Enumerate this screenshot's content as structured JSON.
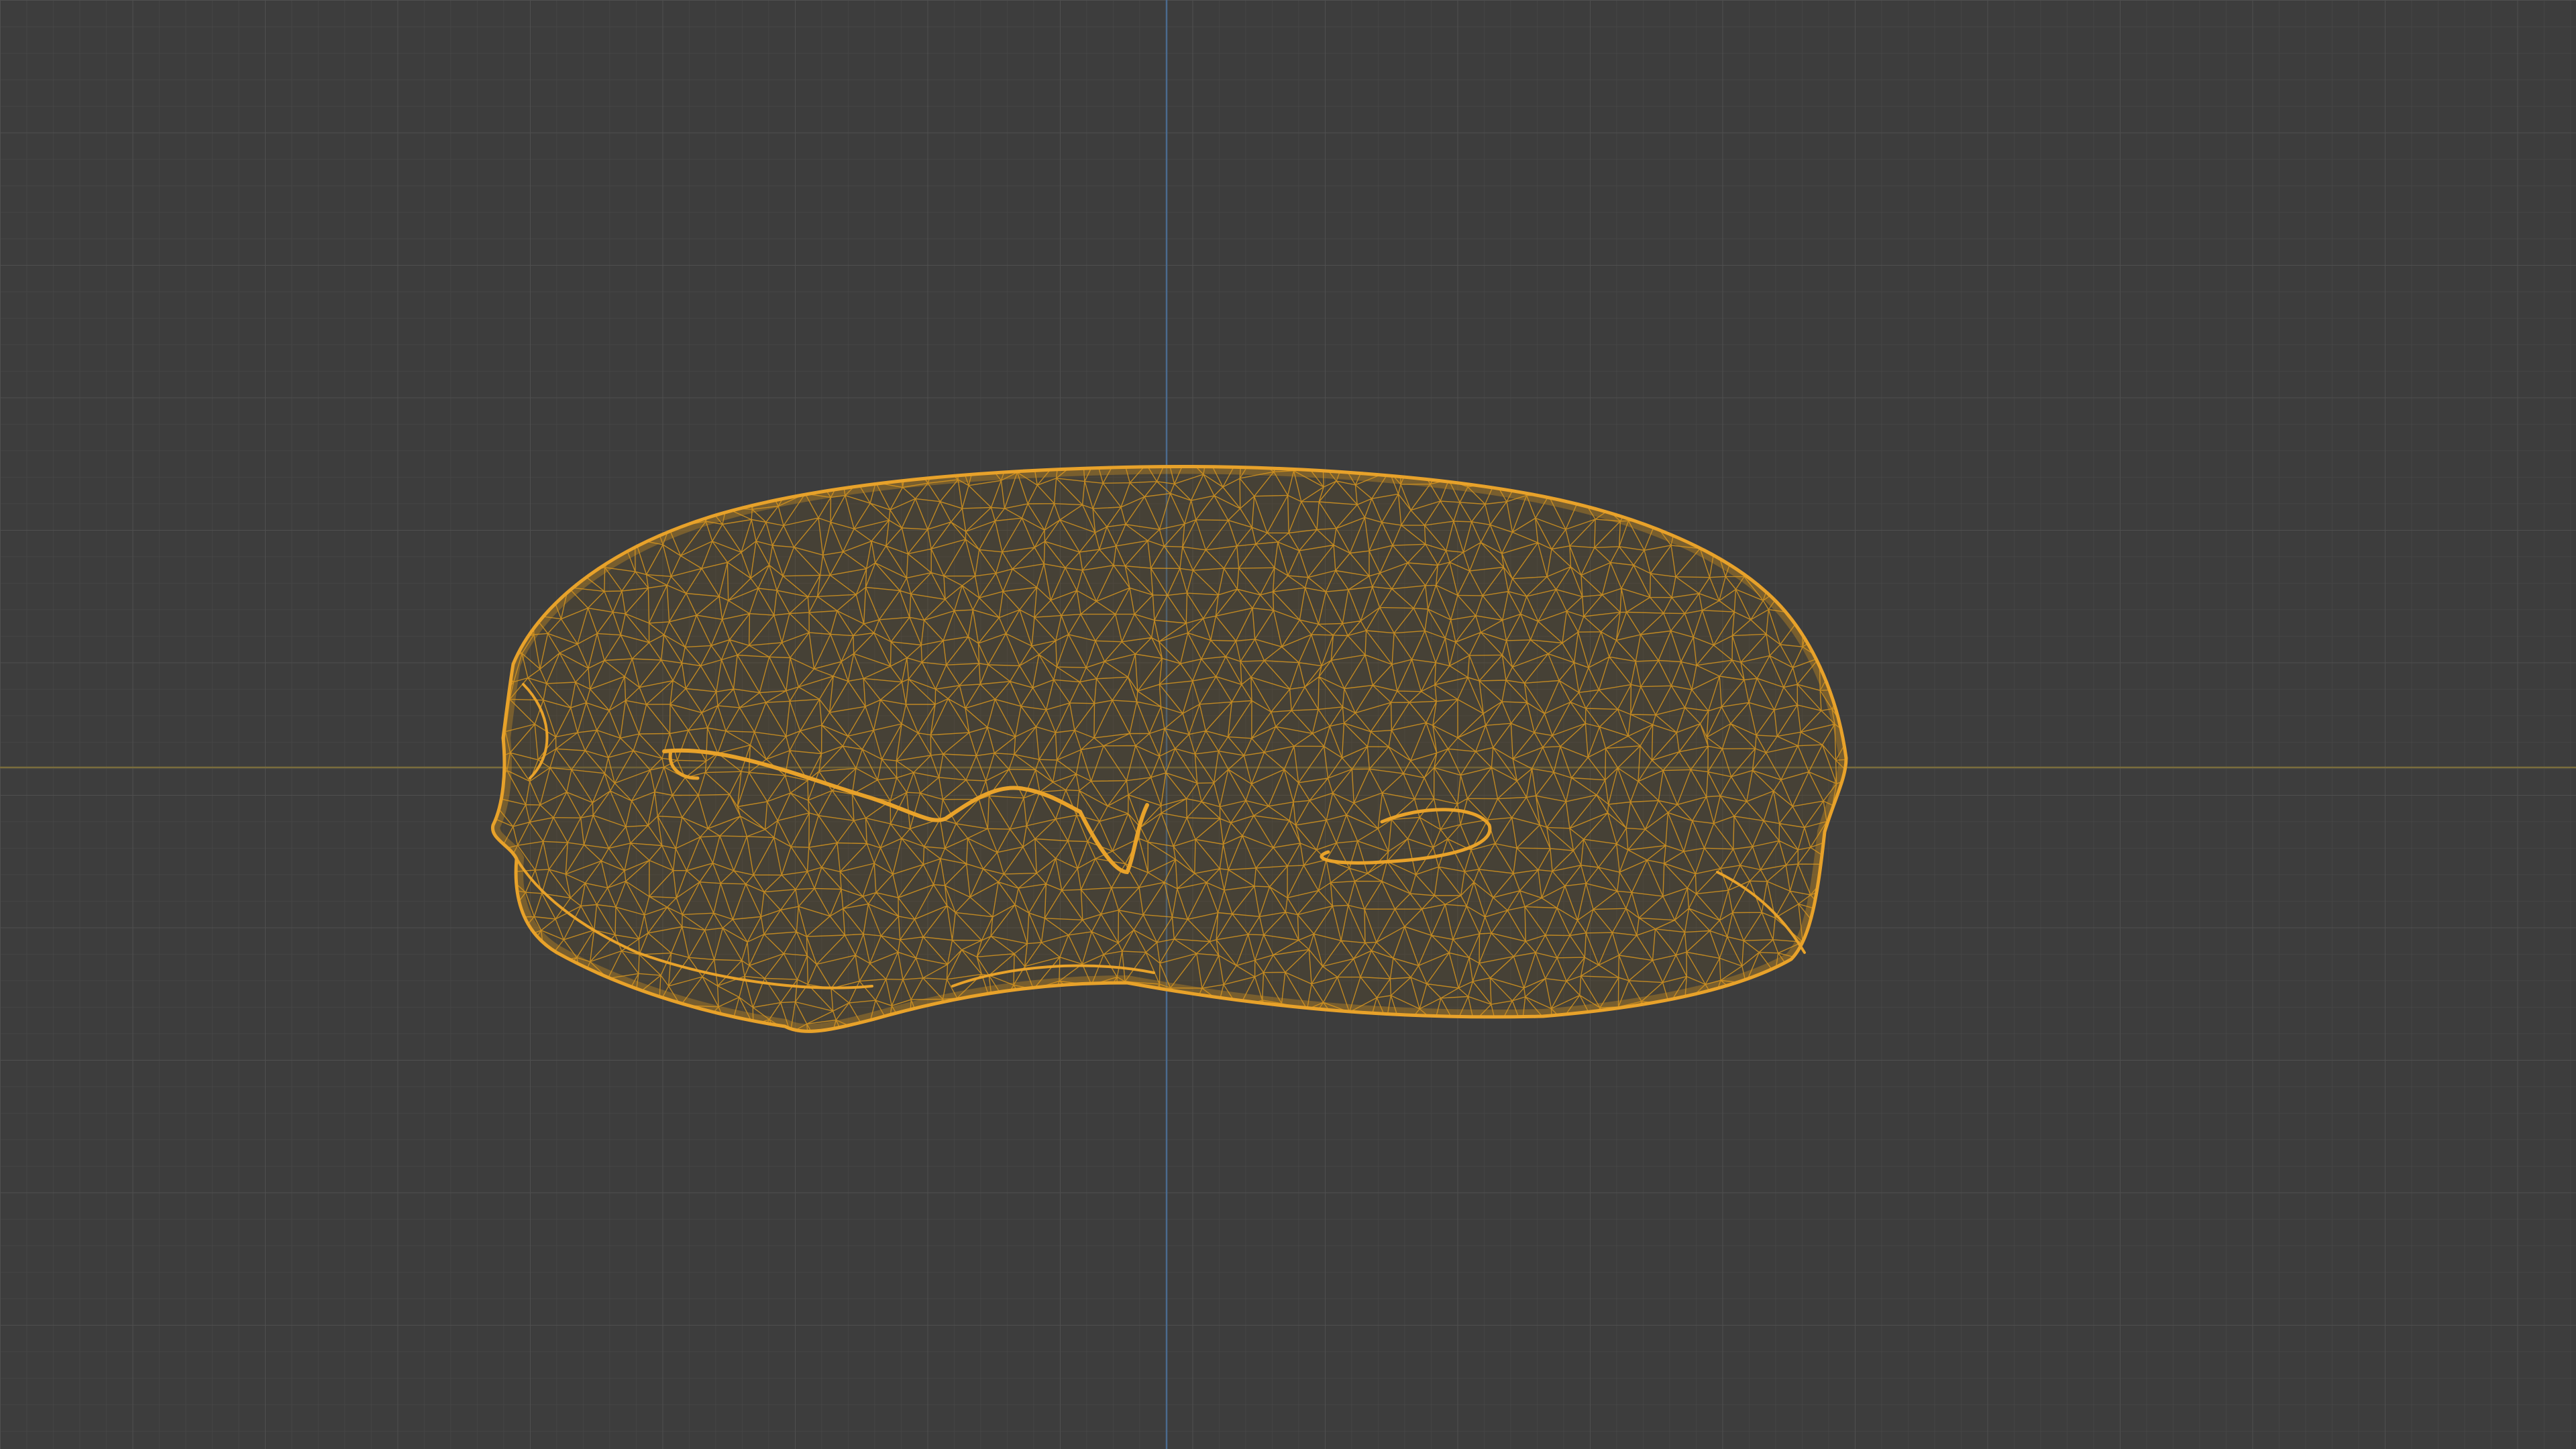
{
  "viewport": {
    "view": "front-orthographic",
    "shading_mode": "wireframe",
    "background_color": "#3d3d3d",
    "grid_minor_color": "#474747",
    "grid_major_color": "#505050",
    "x_axis_color": "#7a6d3d",
    "z_axis_color": "#4a6a8e",
    "selected_object_color": "#e8a22a",
    "selected_object": {
      "type": "mesh",
      "icon": "mesh-object-icon",
      "state": "selected"
    }
  }
}
